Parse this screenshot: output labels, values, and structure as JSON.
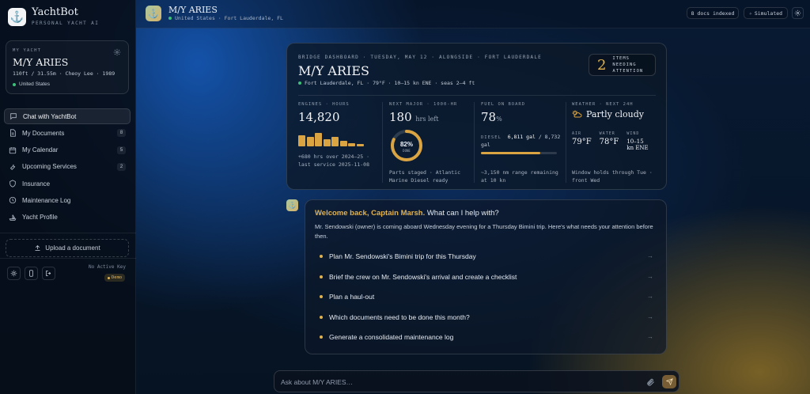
{
  "brand": {
    "name": "YachtBot",
    "tagline": "PERSONAL YACHT AI"
  },
  "yacht": {
    "label": "MY YACHT",
    "name": "M/Y ARIES",
    "specs": "110ft / 31.55m · Cheoy Lee · 1989",
    "flag": "United States"
  },
  "nav": [
    {
      "label": "Chat with YachtBot",
      "icon": "chat-icon",
      "badge": "",
      "active": true
    },
    {
      "label": "My Documents",
      "icon": "document-icon",
      "badge": "8"
    },
    {
      "label": "My Calendar",
      "icon": "calendar-icon",
      "badge": "5"
    },
    {
      "label": "Upcoming Services",
      "icon": "wrench-icon",
      "badge": "2"
    },
    {
      "label": "Insurance",
      "icon": "shield-icon",
      "badge": ""
    },
    {
      "label": "Maintenance Log",
      "icon": "log-icon",
      "badge": ""
    },
    {
      "label": "Yacht Profile",
      "icon": "ship-icon",
      "badge": ""
    }
  ],
  "upload": {
    "label": "Upload a document"
  },
  "footer": {
    "key_status": "No Active Key",
    "mode_badge": "Demo"
  },
  "topbar": {
    "title": "M/Y ARIES",
    "subtitle": "United States · Fort Lauderdale, FL",
    "docs_chip": "8 docs indexed",
    "mode_chip": "Simulated"
  },
  "dashboard": {
    "eyebrow": "BRIDGE DASHBOARD · TUESDAY, MAY 12 · ALONGSIDE · FORT LAUDERDALE",
    "title": "M/Y ARIES",
    "location": "Fort Lauderdale, FL · 79°F · 10–15 kn ENE · seas 2–4 ft",
    "attention": {
      "count": "2",
      "label": "ITEMS NEEDING ATTENTION"
    },
    "engines": {
      "label": "ENGINES · HOURS",
      "value": "14,820",
      "note": "+680 hrs over 2024–25 · last service 2025-11-08",
      "bars": [
        0.7,
        0.6,
        0.85,
        0.45,
        0.6,
        0.35,
        0.22,
        0.15
      ]
    },
    "major": {
      "label": "NEXT MAJOR · 1000-HR",
      "value": "180",
      "unit": "hrs left",
      "percent": 82,
      "percent_label": "82%",
      "done_label": "DONE",
      "note": "Parts staged · Atlantic Marine Diesel ready"
    },
    "fuel": {
      "label": "FUEL ON BOARD",
      "value": "78",
      "unit": "%",
      "diesel_label": "DIESEL",
      "diesel_amount": "6,811 gal",
      "diesel_capacity": "/ 8,732 gal",
      "fraction": 0.78,
      "note": "~3,150 nm range remaining at 10 kn"
    },
    "weather": {
      "label": "WEATHER · NEXT 24H",
      "condition": "Partly cloudy",
      "air_label": "AIR",
      "air": "79°F",
      "water_label": "WATER",
      "water": "78°F",
      "wind_label": "WIND",
      "wind": "10–15 kn ENE",
      "note": "Window holds through Tue · front Wed"
    }
  },
  "chat": {
    "greeting_name": "Welcome back, Captain Marsh.",
    "greeting_rest": "What can I help with?",
    "body": "Mr. Sendowski (owner) is coming aboard Wednesday evening for a Thursday Bimini trip. Here's what needs your attention before then.",
    "suggestions": [
      "Plan Mr. Sendowski's Bimini trip for this Thursday",
      "Brief the crew on Mr. Sendowski's arrival and create a checklist",
      "Plan a haul-out",
      "Which documents need to be done this month?",
      "Generate a consolidated maintenance log"
    ]
  },
  "input": {
    "placeholder": "Ask about M/Y ARIES…",
    "value": ""
  },
  "colors": {
    "accent": "#e2b24e",
    "status_green": "#3ec07a",
    "bar": "#d9a441"
  }
}
